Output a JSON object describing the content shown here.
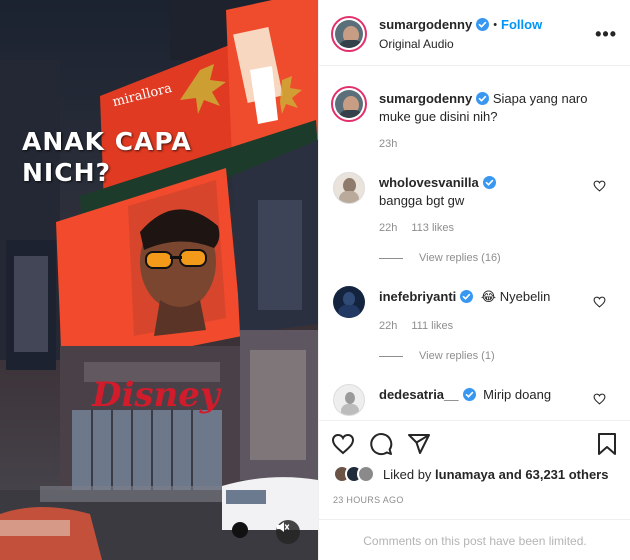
{
  "media": {
    "overlay_text": "ANAK CAPA\nNICH?",
    "billboard_brand": "mirallora",
    "store_sign": "Disney",
    "mute_icon": "speaker-muted-icon"
  },
  "post": {
    "author": "sumargodenny",
    "follow_label": "Follow",
    "dot": "•",
    "audio_label": "Original Audio",
    "more_label": "•••",
    "caption": "Siapa yang naro muke gue disini nih?",
    "caption_time": "23h"
  },
  "comments": [
    {
      "user": "wholovesvanilla",
      "text": "bangga bgt gw",
      "time": "22h",
      "likes": "113 likes",
      "view_replies": "View replies (16)"
    },
    {
      "user": "inefebriyanti",
      "text": "😂 Nyebelin",
      "time": "22h",
      "likes": "111 likes",
      "view_replies": "View replies (1)"
    },
    {
      "user": "dedesatria__",
      "text": "Mirip doang"
    }
  ],
  "footer": {
    "liked_by_prefix": "Liked by ",
    "liked_by_user": "lunamaya",
    "liked_by_suffix": " and 63,231 others",
    "time_ago": "23 HOURS AGO",
    "comments_limited": "Comments on this post have been limited."
  },
  "icons": {
    "like": "heart-icon",
    "comment": "comment-bubble-icon",
    "share": "paper-plane-icon",
    "save": "bookmark-icon",
    "verified": "verified-badge-icon"
  },
  "colors": {
    "accent": "#0095f6",
    "verified": "#3897f0",
    "meta_text": "#8e8e8e",
    "billboard_red": "#e8402a"
  }
}
